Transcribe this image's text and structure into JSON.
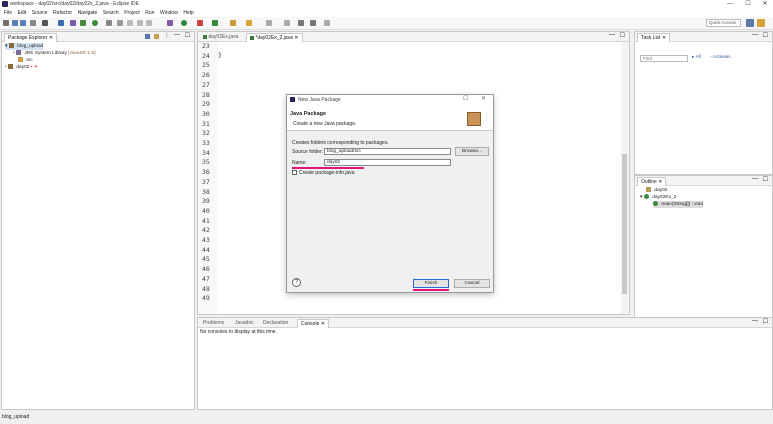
{
  "window": {
    "title": "workspace - day02/src/day02/day02x_2.java - Eclipse IDE",
    "minimize": "—",
    "maximize": "☐",
    "close": "✕"
  },
  "menu": [
    "File",
    "Edit",
    "Source",
    "Refactor",
    "Navigate",
    "Search",
    "Project",
    "Run",
    "Window",
    "Help"
  ],
  "toolbar": {
    "quick_access": "Quick Access"
  },
  "package_explorer": {
    "tab": "Package Explorer",
    "items": [
      {
        "label": "blog_upload",
        "expanded": true
      },
      {
        "label": "JRE System Library",
        "suffix": "[JavaSE-1.8]"
      },
      {
        "label": "src"
      },
      {
        "label": "day02"
      }
    ]
  },
  "editor": {
    "tabs": [
      "day02Ex.java",
      "*day02Ex_2.java"
    ],
    "lines": [
      "23",
      "24",
      "25",
      "26",
      "27",
      "28",
      "29",
      "30",
      "31",
      "32",
      "33",
      "34",
      "35",
      "36",
      "37",
      "38",
      "39",
      "40",
      "41",
      "42",
      "43",
      "44",
      "45",
      "46",
      "47",
      "48",
      "49"
    ],
    "brace": "}"
  },
  "task_list": {
    "tab": "Task List",
    "find_placeholder": "Find",
    "all": "All",
    "activate": "Activate..."
  },
  "outline": {
    "tab": "Outline",
    "items": [
      "day02",
      "day02Ex_2",
      "main(String[]) : void"
    ]
  },
  "bottom_panel": {
    "tabs": [
      "Problems",
      "Javadoc",
      "Declaration",
      "Console"
    ],
    "message": "No consoles to display at this time."
  },
  "dialog": {
    "title": "New Java Package",
    "header_title": "Java Package",
    "header_desc": "Create a new Java package.",
    "body_desc": "Creates folders corresponding to packages.",
    "source_folder_label": "Source folder:",
    "source_folder_value": "blog_upload/src",
    "browse_label": "Browse...",
    "name_label": "Name:",
    "name_value": "day02",
    "checkbox_label": "Create package-info.java",
    "help_label": "?",
    "finish_label": "Finish",
    "cancel_label": "Cancel",
    "accent_color": "#e0147a"
  },
  "status": {
    "text": "blog_upload"
  }
}
